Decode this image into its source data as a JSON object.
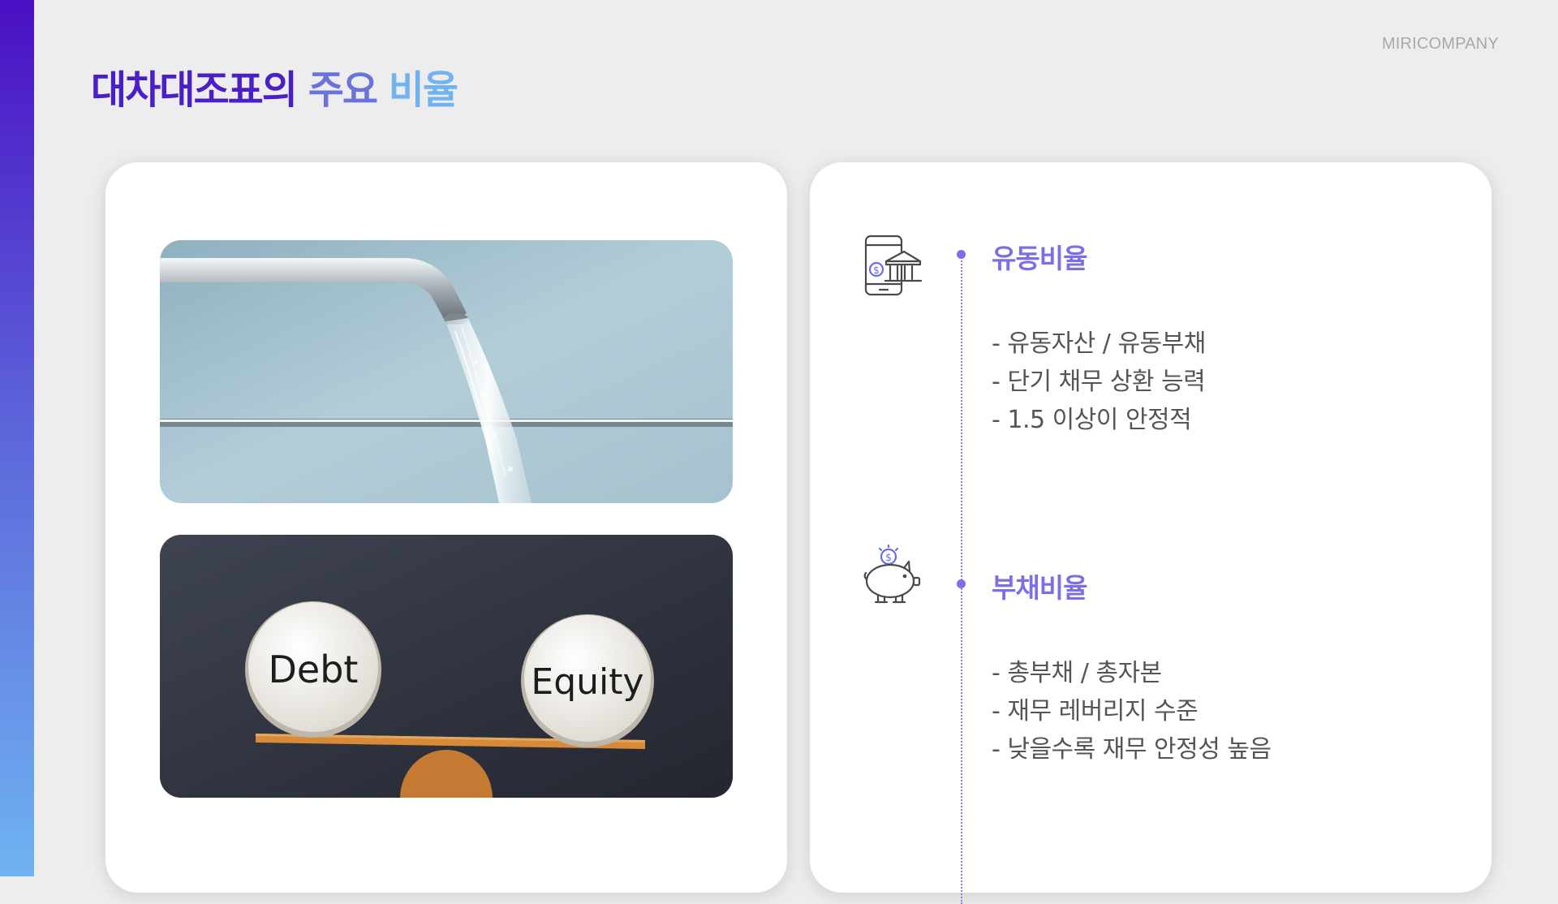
{
  "header": {
    "brand": "MIRICOMPANY",
    "title_part1": "대차대조표의",
    "title_part2": "주요",
    "title_part3": "비율"
  },
  "images": [
    {
      "name": "faucet-water-photo"
    },
    {
      "name": "debt-equity-scale-photo",
      "labels": [
        "Debt",
        "Equity"
      ]
    }
  ],
  "sections": [
    {
      "icon": "mobile-bank-icon",
      "title": "유동비율",
      "bullets": [
        "- 유동자산 / 유동부채",
        "- 단기 채무 상환 능력",
        "- 1.5 이상이 안정적"
      ]
    },
    {
      "icon": "piggy-bank-icon",
      "title": "부채비율",
      "bullets": [
        "- 총부채 / 총자본",
        "- 재무 레버리지 수준",
        "- 낮을수록 재무 안정성 높음"
      ]
    }
  ],
  "colors": {
    "accent_purple": "#4a1fc7",
    "accent_mid": "#6a72dc",
    "accent_light": "#72b3ef",
    "section_title": "#7b6fe8"
  }
}
